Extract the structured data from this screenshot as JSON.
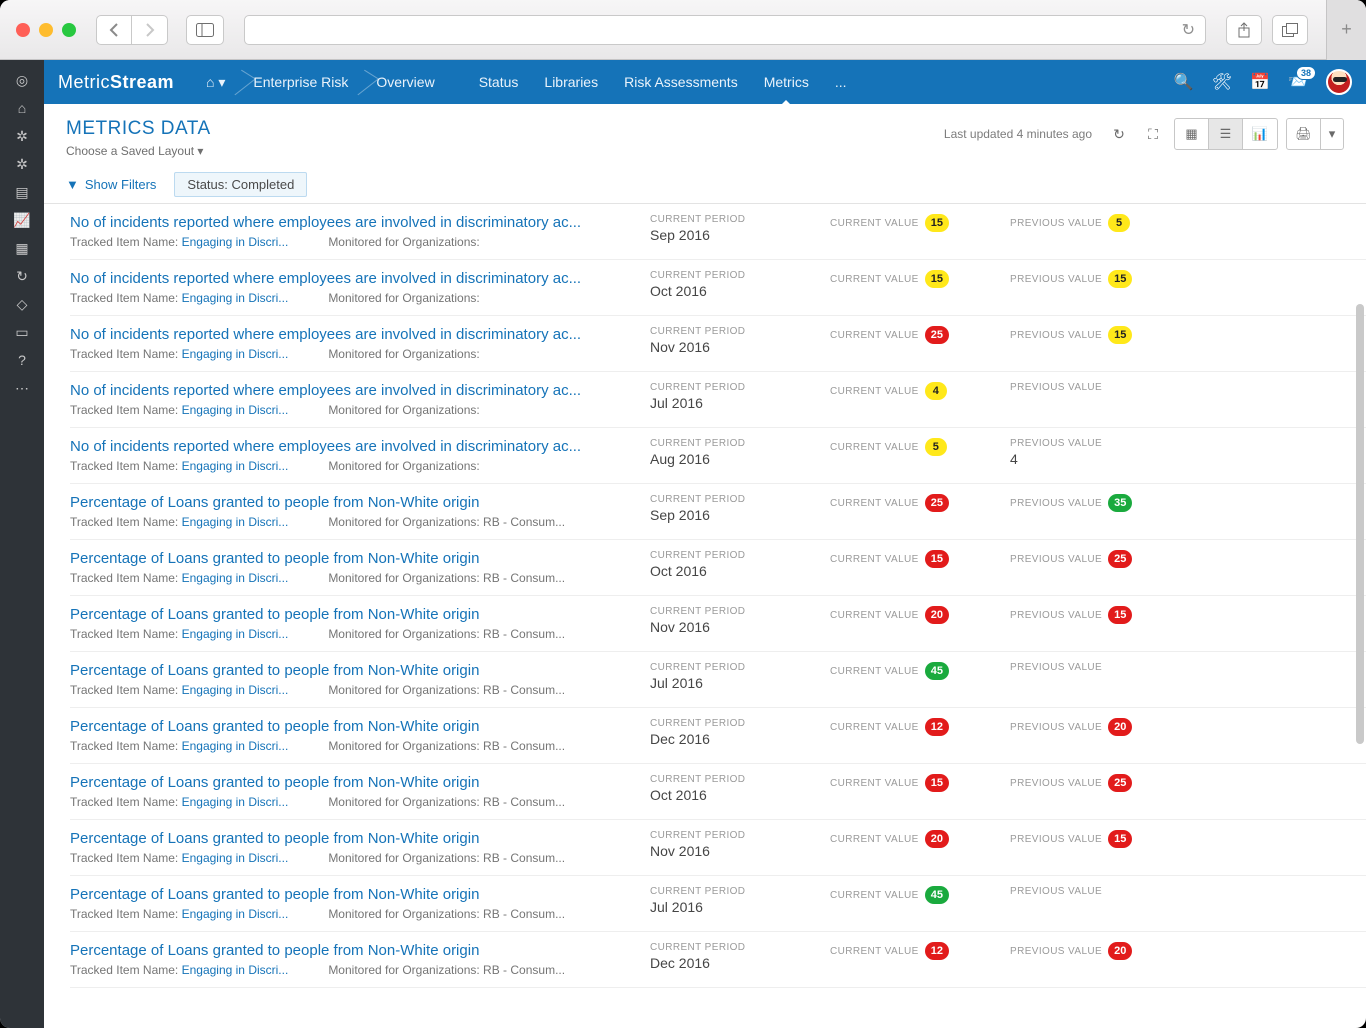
{
  "browser": {
    "reload_icon": "↻",
    "share_icon": "⇪",
    "tabs_icon": "⧉",
    "new_tab": "+"
  },
  "brand": {
    "part1": "Metric",
    "part2": "Stream"
  },
  "breadcrumbs": [
    {
      "label": "⌂",
      "dropdown": true
    },
    {
      "label": "Enterprise Risk"
    },
    {
      "label": "Overview"
    }
  ],
  "nav": {
    "tabs": [
      "Status",
      "Libraries",
      "Risk Assessments",
      "Metrics",
      "..."
    ],
    "active": "Metrics"
  },
  "topicons": {
    "search": "⌕",
    "tools": "✕",
    "calendar": "☷",
    "inbox": "✉",
    "badge": "38"
  },
  "page": {
    "title": "METRICS DATA",
    "saved_layout": "Choose a Saved Layout ▾",
    "last_updated": "Last updated 4 minutes ago"
  },
  "filters": {
    "show_label": "Show Filters",
    "chip": "Status: Completed"
  },
  "column_labels": {
    "period": "CURRENT PERIOD",
    "current": "CURRENT VALUE",
    "previous": "PREVIOUS VALUE"
  },
  "row_labels": {
    "tracked_item": "Tracked Item Name:",
    "tracked_link": "Engaging in Discri...",
    "monitored": "Monitored for Organizations:",
    "monitored_org": "RB - Consum..."
  },
  "rows": [
    {
      "title": "No of incidents reported where employees are involved in discriminatory ac...",
      "org": "",
      "period": "Sep 2016",
      "current": {
        "v": "15",
        "c": "yellow"
      },
      "previous": {
        "v": "5",
        "c": "yellow"
      }
    },
    {
      "title": "No of incidents reported where employees are involved in discriminatory ac...",
      "org": "",
      "period": "Oct 2016",
      "current": {
        "v": "15",
        "c": "yellow"
      },
      "previous": {
        "v": "15",
        "c": "yellow"
      }
    },
    {
      "title": "No of incidents reported where employees are involved in discriminatory ac...",
      "org": "",
      "period": "Nov 2016",
      "current": {
        "v": "25",
        "c": "red"
      },
      "previous": {
        "v": "15",
        "c": "yellow"
      }
    },
    {
      "title": "No of incidents reported where employees are involved in discriminatory ac...",
      "org": "",
      "period": "Jul 2016",
      "current": {
        "v": "4",
        "c": "yellow"
      },
      "previous": {
        "v": "",
        "c": ""
      }
    },
    {
      "title": "No of incidents reported where employees are involved in discriminatory ac...",
      "org": "",
      "period": "Aug 2016",
      "current": {
        "v": "5",
        "c": "yellow"
      },
      "previous": {
        "v": "4",
        "c": "plain"
      }
    },
    {
      "title": "Percentage of Loans granted to people from Non-White origin",
      "org": "RB - Consum...",
      "period": "Sep 2016",
      "current": {
        "v": "25",
        "c": "red"
      },
      "previous": {
        "v": "35",
        "c": "green"
      }
    },
    {
      "title": "Percentage of Loans granted to people from Non-White origin",
      "org": "RB - Consum...",
      "period": "Oct 2016",
      "current": {
        "v": "15",
        "c": "red"
      },
      "previous": {
        "v": "25",
        "c": "red"
      }
    },
    {
      "title": "Percentage of Loans granted to people from Non-White origin",
      "org": "RB - Consum...",
      "period": "Nov 2016",
      "current": {
        "v": "20",
        "c": "red"
      },
      "previous": {
        "v": "15",
        "c": "red"
      }
    },
    {
      "title": "Percentage of Loans granted to people from Non-White origin",
      "org": "RB - Consum...",
      "period": "Jul 2016",
      "current": {
        "v": "45",
        "c": "green"
      },
      "previous": {
        "v": "",
        "c": ""
      }
    },
    {
      "title": "Percentage of Loans granted to people from Non-White origin",
      "org": "RB - Consum...",
      "period": "Dec 2016",
      "current": {
        "v": "12",
        "c": "red"
      },
      "previous": {
        "v": "20",
        "c": "red"
      }
    },
    {
      "title": "Percentage of Loans granted to people from Non-White origin",
      "org": "RB - Consum...",
      "period": "Oct 2016",
      "current": {
        "v": "15",
        "c": "red"
      },
      "previous": {
        "v": "25",
        "c": "red"
      }
    },
    {
      "title": "Percentage of Loans granted to people from Non-White origin",
      "org": "RB - Consum...",
      "period": "Nov 2016",
      "current": {
        "v": "20",
        "c": "red"
      },
      "previous": {
        "v": "15",
        "c": "red"
      }
    },
    {
      "title": "Percentage of Loans granted to people from Non-White origin",
      "org": "RB - Consum...",
      "period": "Jul 2016",
      "current": {
        "v": "45",
        "c": "green"
      },
      "previous": {
        "v": "",
        "c": ""
      }
    },
    {
      "title": "Percentage of Loans granted to people from Non-White origin",
      "org": "RB - Consum...",
      "period": "Dec 2016",
      "current": {
        "v": "12",
        "c": "red"
      },
      "previous": {
        "v": "20",
        "c": "red"
      }
    }
  ]
}
